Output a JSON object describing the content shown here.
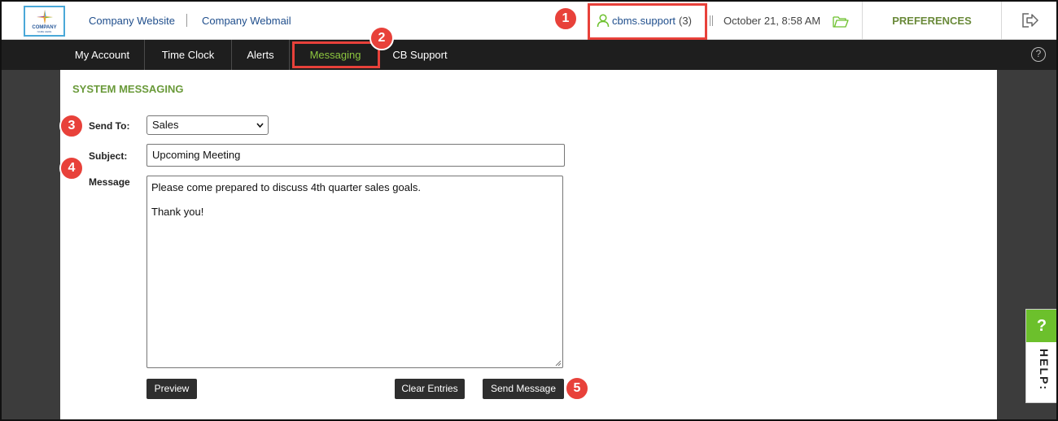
{
  "header": {
    "logo_text": "COMPANY",
    "logo_sub": "NAME HERE",
    "links": [
      "Company Website",
      "Company Webmail"
    ],
    "user_name": "cbms.support",
    "user_count": "(3)",
    "datetime": "October 21, 8:58 AM",
    "preferences": "PREFERENCES"
  },
  "nav": {
    "items": [
      "My Account",
      "Time Clock",
      "Alerts",
      "Messaging",
      "CB Support"
    ],
    "active": "Messaging",
    "help_glyph": "?"
  },
  "page": {
    "title": "SYSTEM MESSAGING",
    "send_to_label": "Send To:",
    "send_to_value": "Sales",
    "subject_label": "Subject:",
    "subject_value": "Upcoming Meeting",
    "message_label": "Message",
    "message_lines": [
      "Please come prepared to discuss 4th quarter sales goals.",
      "Thank you!"
    ],
    "buttons": {
      "preview": "Preview",
      "clear": "Clear Entries",
      "send": "Send Message"
    }
  },
  "annotations": [
    "1",
    "2",
    "3",
    "4",
    "5"
  ],
  "help_tab": {
    "glyph": "?",
    "label": "HELP:"
  },
  "colors": {
    "accent_green": "#8dc63f",
    "title_green": "#6a9a3a",
    "annotation_red": "#e8413a",
    "nav_bg": "#1e1e1e",
    "link_blue": "#1f4e8c"
  },
  "icons": [
    "user-icon",
    "folder-icon",
    "logout-icon",
    "help-circle-icon",
    "chevron-down-icon",
    "resize-grip-icon"
  ]
}
